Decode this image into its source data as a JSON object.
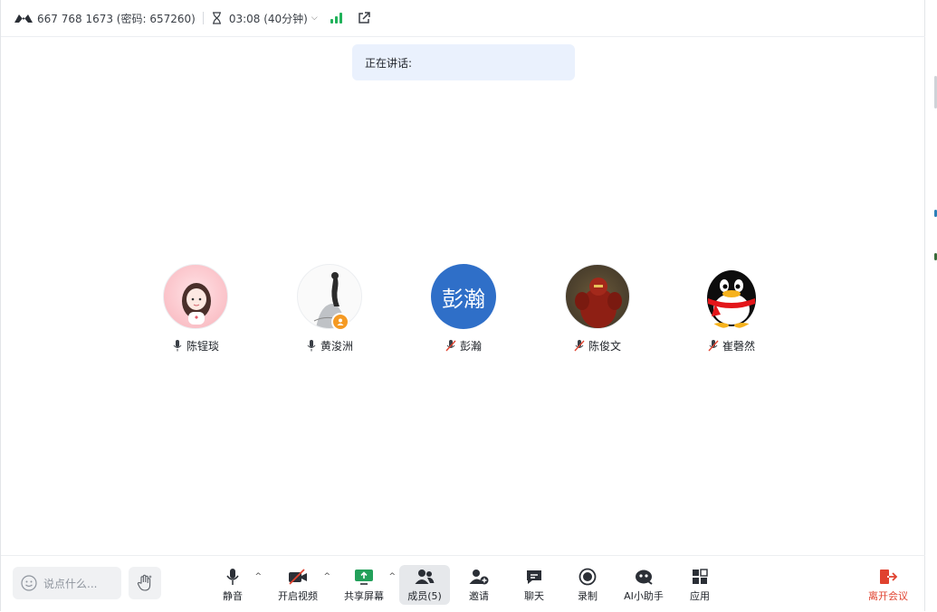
{
  "topbar": {
    "meeting_id": "667 768 1673 (密码: 657260)",
    "timer": "03:08 (40分钟)"
  },
  "speaking_label": "正在讲话:",
  "participants": [
    {
      "name": "陈锃琰",
      "mic": "on"
    },
    {
      "name": "黄浚洲",
      "mic": "on",
      "badge": "host"
    },
    {
      "name": "彭瀚",
      "mic": "muted",
      "avatar_text": "彭瀚"
    },
    {
      "name": "陈俊文",
      "mic": "muted"
    },
    {
      "name": "崔磬然",
      "mic": "muted"
    }
  ],
  "toolbar": {
    "chat_placeholder": "说点什么...",
    "mute": "静音",
    "video": "开启视频",
    "share": "共享屏幕",
    "members": "成员(5)",
    "invite": "邀请",
    "chat": "聊天",
    "record": "录制",
    "ai": "AI小助手",
    "apps": "应用",
    "leave": "离开会议"
  },
  "colors": {
    "accent_blue": "#2f6fc8",
    "signal_green": "#20b25a",
    "leave_red": "#e0422f",
    "banner_bg": "#eaf1fd"
  }
}
